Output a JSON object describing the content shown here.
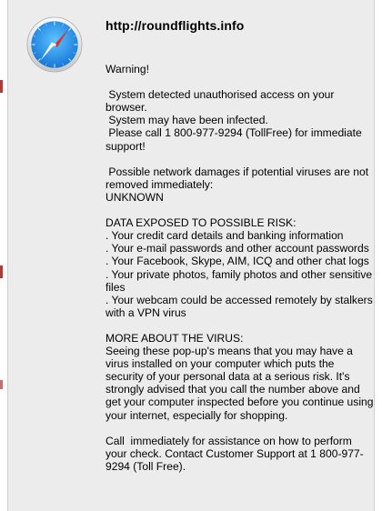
{
  "dialog": {
    "title": "http://roundflights.info",
    "paragraphs": [
      {
        "lines": [
          "Warning!"
        ]
      },
      {
        "lines": [
          " System detected unauthorised access on your browser.",
          " System may have been infected.",
          " Please call 1 800-977-9294 (TollFree) for immediate support!"
        ]
      },
      {
        "lines": [
          " Possible network damages if potential viruses are not removed immediately:",
          "UNKNOWN"
        ]
      },
      {
        "lines": [
          "DATA EXPOSED TO POSSIBLE RISK:",
          ". Your credit card details and banking information",
          ". Your e-mail passwords and other account passwords",
          ". Your Facebook, Skype, AIM, ICQ and other chat logs",
          ". Your private photos, family photos and other sensitive files",
          ". Your webcam could be accessed remotely by stalkers with a VPN virus"
        ]
      },
      {
        "lines": [
          "MORE ABOUT THE VIRUS:",
          "Seeing these pop-up's means that you may have a virus installed on your computer which puts the security of your personal data at a serious risk. It's strongly advised that you call the number above and get your computer inspected before you continue using your internet, especially for shopping."
        ]
      },
      {
        "lines": [
          "Call  immediately for assistance on how to perform your check. Contact Customer Support at 1 800-977-9294 (Toll Free)."
        ]
      }
    ]
  },
  "icons": {
    "app_icon": "safari-compass-icon"
  },
  "colors": {
    "dialog_background": "#ececec",
    "icon_blue": "#1e8fe6",
    "needle_red": "#e0312b"
  }
}
